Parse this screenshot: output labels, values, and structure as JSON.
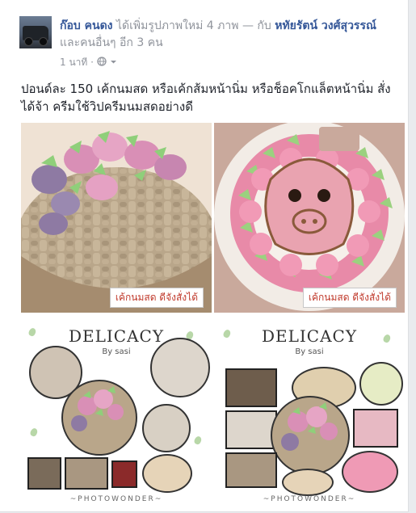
{
  "post": {
    "author": "ก๊อบ คนดง",
    "action": "ได้เพิ่มรูปภาพใหม่ 4 ภาพ — กับ",
    "tagged": "หทัยรัตน์ วงศ์สุวรรณ์",
    "others": "และคนอื่นๆ อีก 3 คน",
    "time": "1 นาที",
    "privacy": "globe-icon",
    "text": "ปอนด์ละ 150 เค้กนมสด หรือเค้กส้มหน้านิ่ม หรือช็อคโกแล็ตหน้านิ่ม สั่งได้จ้า ครีมใช้วิปครีมนมสดอย่างดี"
  },
  "photos": {
    "label": "เค้กนมสด ดีจังสั่งได้",
    "collage_title": "DELICACY",
    "collage_sub": "By sasi",
    "collage_foot": "~PHOTOWONDER~"
  },
  "colors": {
    "link": "#365899",
    "muted": "#90949c",
    "text": "#1d2129"
  }
}
